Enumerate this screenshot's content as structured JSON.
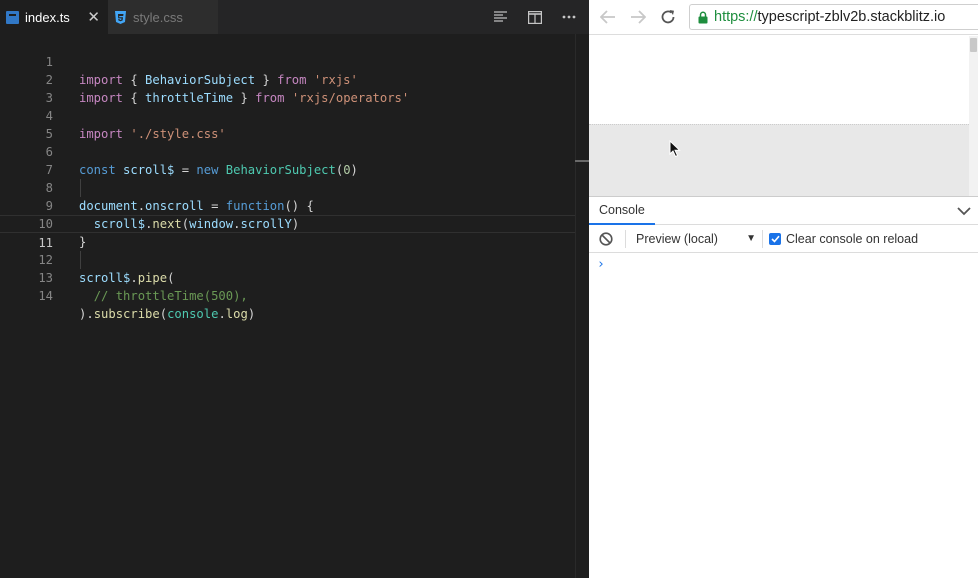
{
  "editor": {
    "tabs": [
      {
        "label": "index.ts",
        "active": true,
        "icon": "typescript-file-icon"
      },
      {
        "label": "style.css",
        "active": false,
        "icon": "css-file-icon"
      }
    ],
    "close_glyph": "✕",
    "current_line": 11,
    "lines": [
      {
        "n": "1"
      },
      {
        "n": "2"
      },
      {
        "n": "3"
      },
      {
        "n": "4"
      },
      {
        "n": "5"
      },
      {
        "n": "6"
      },
      {
        "n": "7"
      },
      {
        "n": "8"
      },
      {
        "n": "9"
      },
      {
        "n": "10"
      },
      {
        "n": "11"
      },
      {
        "n": "12"
      },
      {
        "n": "13"
      },
      {
        "n": "14"
      }
    ],
    "code": {
      "l1": [
        "import",
        " { ",
        "BehaviorSubject",
        " } ",
        "from",
        " ",
        "'rxjs'"
      ],
      "l2": [
        "import",
        " { ",
        "throttleTime",
        " } ",
        "from",
        " ",
        "'rxjs/operators'"
      ],
      "l4": [
        "import",
        " ",
        "'./style.css'"
      ],
      "l6": [
        "const",
        " ",
        "scroll$",
        " = ",
        "new",
        " ",
        "BehaviorSubject",
        "(",
        "0",
        ")"
      ],
      "l8": [
        "document",
        ".",
        "onscroll",
        " = ",
        "function",
        "() {"
      ],
      "l9": [
        "  ",
        "scroll$",
        ".",
        "next",
        "(",
        "window",
        ".",
        "scrollY",
        ")"
      ],
      "l10": [
        "}"
      ],
      "l12": [
        "scroll$",
        ".",
        "pipe",
        "("
      ],
      "l13": [
        "  ",
        "// throttleTime(500),"
      ],
      "l14": [
        ").",
        "subscribe",
        "(",
        "console",
        ".",
        "log",
        ")"
      ]
    }
  },
  "browser": {
    "url_scheme": "https://",
    "url_host": "typescript-zblv2b.stackblitz.io",
    "console": {
      "tab_label": "Console",
      "context": "Preview (local)",
      "context_arrow": "▼",
      "clear_on_reload_label": "Clear console on reload",
      "clear_on_reload_checked": true,
      "prompt": "›"
    }
  },
  "colors": {
    "editor_bg": "#1e1e1e",
    "keyword": "#c586c0",
    "string": "#ce9178",
    "variable": "#9cdcfe",
    "class": "#4ec9b0",
    "function": "#dcdcaa",
    "comment": "#6a9955",
    "accent": "#1a73e8",
    "secure_green": "#1e8e3e"
  }
}
